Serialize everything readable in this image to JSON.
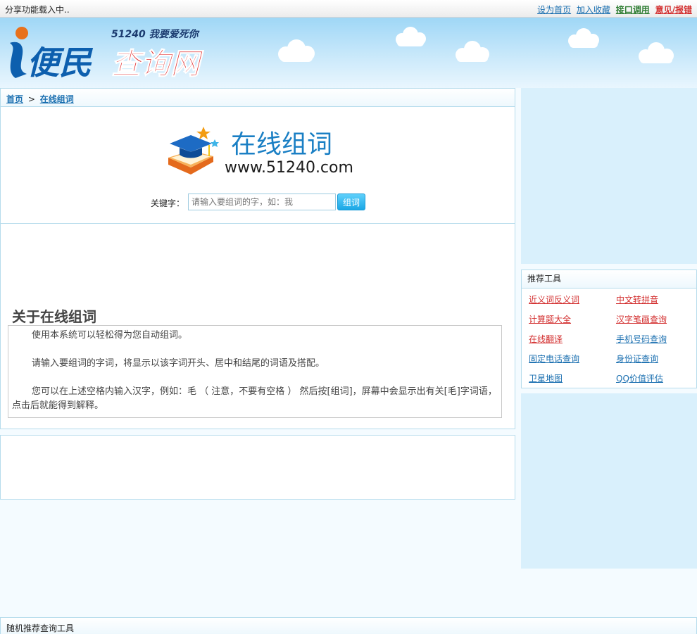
{
  "topbar": {
    "share_status": "分享功能载入中..",
    "links": [
      {
        "label": "设为首页",
        "color": "#1a6fb0"
      },
      {
        "label": "加入收藏",
        "color": "#1a6fb0"
      },
      {
        "label": "接口调用",
        "color": "#2e7d32"
      },
      {
        "label": "意见/报错",
        "color": "#d32f2f"
      }
    ]
  },
  "header": {
    "logo_text_main_1": "便民",
    "logo_text_main_2": "查询网",
    "logo_slogan": "51240 我要爱死你"
  },
  "breadcrumb": {
    "home": "首页",
    "separator": ">",
    "current": "在线组词"
  },
  "search": {
    "banner_title": "在线组词",
    "banner_url": "www.51240.com",
    "label": "关键字：",
    "placeholder": "请输入要组词的字，如：我",
    "button": "组词"
  },
  "about": {
    "title": "关于在线组词",
    "paragraphs": [
      "使用本系统可以轻松得为您自动组词。",
      "请输入要组词的字词，将显示以该字词开头、居中和结尾的词语及搭配。",
      "您可以在上述空格内输入汉字，例如：毛 （ 注意，不要有空格 ） 然后按[组词]，屏幕中会显示出有关[毛]字词语，点击后就能得到解释。"
    ]
  },
  "tools": {
    "title": "推荐工具",
    "items": [
      {
        "label": "近义词反义词",
        "color": "#d32f2f"
      },
      {
        "label": "中文转拼音",
        "color": "#d32f2f"
      },
      {
        "label": "计算题大全",
        "color": "#d32f2f"
      },
      {
        "label": "汉字笔画查询",
        "color": "#d32f2f"
      },
      {
        "label": "在线翻译",
        "color": "#d32f2f"
      },
      {
        "label": "手机号码查询",
        "color": "#1a6fb0"
      },
      {
        "label": "固定电话查询",
        "color": "#1a6fb0"
      },
      {
        "label": "身份证查询",
        "color": "#1a6fb0"
      },
      {
        "label": "卫星地图",
        "color": "#1a6fb0"
      },
      {
        "label": "QQ价值评估",
        "color": "#1a6fb0"
      }
    ]
  },
  "bottom": {
    "title": "随机推荐查询工具"
  }
}
